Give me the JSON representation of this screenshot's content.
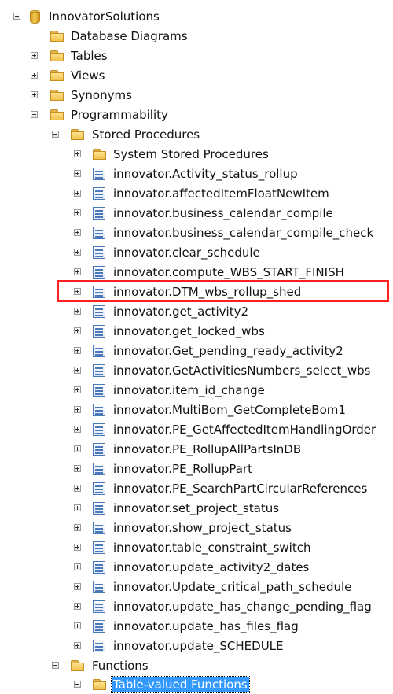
{
  "tree": {
    "root": "InnovatorSolutions",
    "database_diagrams": "Database Diagrams",
    "tables": "Tables",
    "views": "Views",
    "synonyms": "Synonyms",
    "programmability": "Programmability",
    "stored_procedures": "Stored Procedures",
    "system_stored_procedures": "System Stored Procedures",
    "procedures": [
      "innovator.Activity_status_rollup",
      "innovator.affectedItemFloatNewItem",
      "innovator.business_calendar_compile",
      "innovator.business_calendar_compile_check",
      "innovator.clear_schedule",
      "innovator.compute_WBS_START_FINISH",
      "innovator.DTM_wbs_rollup_shed",
      "innovator.get_activity2",
      "innovator.get_locked_wbs",
      "innovator.Get_pending_ready_activity2",
      "innovator.GetActivitiesNumbers_select_wbs",
      "innovator.item_id_change",
      "innovator.MultiBom_GetCompleteBom1",
      "innovator.PE_GetAffectedItemHandlingOrder",
      "innovator.PE_RollupAllPartsInDB",
      "innovator.PE_RollupPart",
      "innovator.PE_SearchPartCircularReferences",
      "innovator.set_project_status",
      "innovator.show_project_status",
      "innovator.table_constraint_switch",
      "innovator.update_activity2_dates",
      "innovator.Update_critical_path_schedule",
      "innovator.update_has_change_pending_flag",
      "innovator.update_has_files_flag",
      "innovator.update_SCHEDULE"
    ],
    "functions": "Functions",
    "table_valued_functions": "Table-valued Functions"
  },
  "colors": {
    "highlight_border": "#ff1f1f",
    "selection": "#3399ff"
  }
}
